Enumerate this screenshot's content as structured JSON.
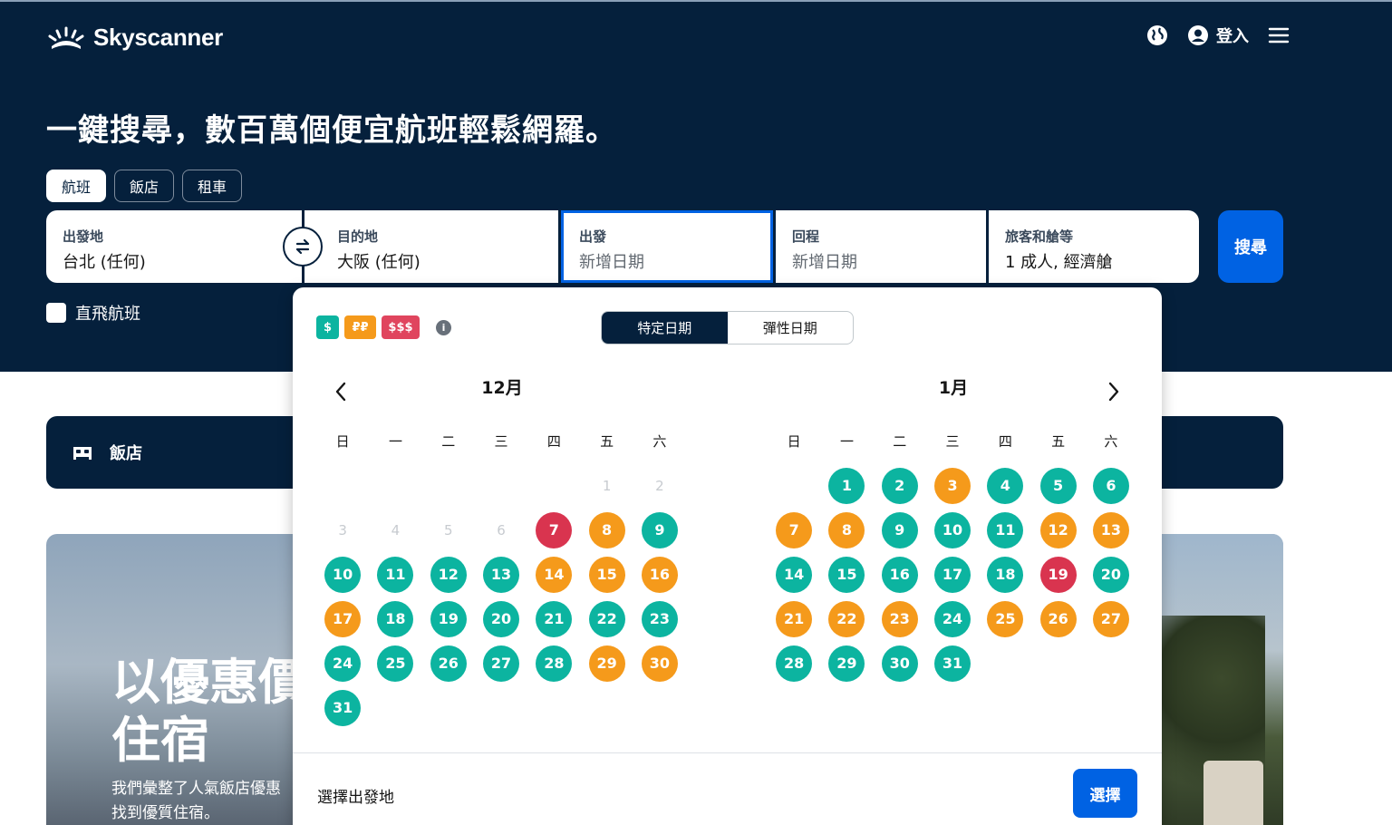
{
  "header": {
    "brand": "Skyscanner",
    "login_label": "登入",
    "icons": [
      "globe-icon",
      "user-icon",
      "menu-icon"
    ]
  },
  "hero": {
    "headline": "一鍵搜尋，數百萬個便宜航班輕鬆網羅。",
    "tabs": [
      {
        "label": "航班",
        "active": true
      },
      {
        "label": "飯店",
        "active": false
      },
      {
        "label": "租車",
        "active": false
      }
    ]
  },
  "search": {
    "origin": {
      "label": "出發地",
      "value": "台北 (任何)"
    },
    "destination": {
      "label": "目的地",
      "value": "大阪 (任何)"
    },
    "depart": {
      "label": "出發",
      "placeholder": "新增日期"
    },
    "return": {
      "label": "回程",
      "placeholder": "新增日期"
    },
    "travellers": {
      "label": "旅客和艙等",
      "value": "1 成人, 經濟艙"
    },
    "search_label": "搜尋",
    "direct_label": "直飛航班"
  },
  "hotel_banner": {
    "label": "飯店"
  },
  "promo": {
    "title_line1": "以優惠價",
    "title_line2": "住宿",
    "sub_line1": "我們彙整了人氣飯店優惠",
    "sub_line2": "找到優質住宿。"
  },
  "datepicker": {
    "legend": [
      "$",
      "₽₽",
      "$$$"
    ],
    "modes": [
      "特定日期",
      "彈性日期"
    ],
    "active_mode": "特定日期",
    "weekdays": [
      "日",
      "一",
      "二",
      "三",
      "四",
      "五",
      "六"
    ],
    "months": [
      {
        "title": "12月",
        "leading_blanks": 5,
        "days": [
          {
            "d": "1",
            "p": "past"
          },
          {
            "d": "2",
            "p": "past"
          },
          {
            "d": "3",
            "p": "past"
          },
          {
            "d": "4",
            "p": "past"
          },
          {
            "d": "5",
            "p": "past"
          },
          {
            "d": "6",
            "p": "past"
          },
          {
            "d": "7",
            "p": "high"
          },
          {
            "d": "8",
            "p": "mid"
          },
          {
            "d": "9",
            "p": "low"
          },
          {
            "d": "10",
            "p": "low"
          },
          {
            "d": "11",
            "p": "low"
          },
          {
            "d": "12",
            "p": "low"
          },
          {
            "d": "13",
            "p": "low"
          },
          {
            "d": "14",
            "p": "mid"
          },
          {
            "d": "15",
            "p": "mid"
          },
          {
            "d": "16",
            "p": "mid"
          },
          {
            "d": "17",
            "p": "mid"
          },
          {
            "d": "18",
            "p": "low"
          },
          {
            "d": "19",
            "p": "low"
          },
          {
            "d": "20",
            "p": "low"
          },
          {
            "d": "21",
            "p": "low"
          },
          {
            "d": "22",
            "p": "low"
          },
          {
            "d": "23",
            "p": "low"
          },
          {
            "d": "24",
            "p": "low"
          },
          {
            "d": "25",
            "p": "low"
          },
          {
            "d": "26",
            "p": "low"
          },
          {
            "d": "27",
            "p": "low"
          },
          {
            "d": "28",
            "p": "low"
          },
          {
            "d": "29",
            "p": "mid"
          },
          {
            "d": "30",
            "p": "mid"
          },
          {
            "d": "31",
            "p": "low"
          }
        ]
      },
      {
        "title": "1月",
        "leading_blanks": 1,
        "days": [
          {
            "d": "1",
            "p": "low"
          },
          {
            "d": "2",
            "p": "low"
          },
          {
            "d": "3",
            "p": "mid"
          },
          {
            "d": "4",
            "p": "low"
          },
          {
            "d": "5",
            "p": "low"
          },
          {
            "d": "6",
            "p": "low"
          },
          {
            "d": "7",
            "p": "mid"
          },
          {
            "d": "8",
            "p": "mid"
          },
          {
            "d": "9",
            "p": "low"
          },
          {
            "d": "10",
            "p": "low"
          },
          {
            "d": "11",
            "p": "low"
          },
          {
            "d": "12",
            "p": "mid"
          },
          {
            "d": "13",
            "p": "mid"
          },
          {
            "d": "14",
            "p": "low"
          },
          {
            "d": "15",
            "p": "low"
          },
          {
            "d": "16",
            "p": "low"
          },
          {
            "d": "17",
            "p": "low"
          },
          {
            "d": "18",
            "p": "low"
          },
          {
            "d": "19",
            "p": "high"
          },
          {
            "d": "20",
            "p": "low"
          },
          {
            "d": "21",
            "p": "mid"
          },
          {
            "d": "22",
            "p": "mid"
          },
          {
            "d": "23",
            "p": "mid"
          },
          {
            "d": "24",
            "p": "low"
          },
          {
            "d": "25",
            "p": "mid"
          },
          {
            "d": "26",
            "p": "mid"
          },
          {
            "d": "27",
            "p": "mid"
          },
          {
            "d": "28",
            "p": "low"
          },
          {
            "d": "29",
            "p": "low"
          },
          {
            "d": "30",
            "p": "low"
          },
          {
            "d": "31",
            "p": "low"
          }
        ]
      }
    ],
    "footer_text": "選擇出發地",
    "select_label": "選擇"
  },
  "colors": {
    "navy": "#05203c",
    "blue": "#0062e3",
    "low_price": "#0cb4a0",
    "mid_price": "#f59a1b",
    "high_price": "#d9344f"
  }
}
